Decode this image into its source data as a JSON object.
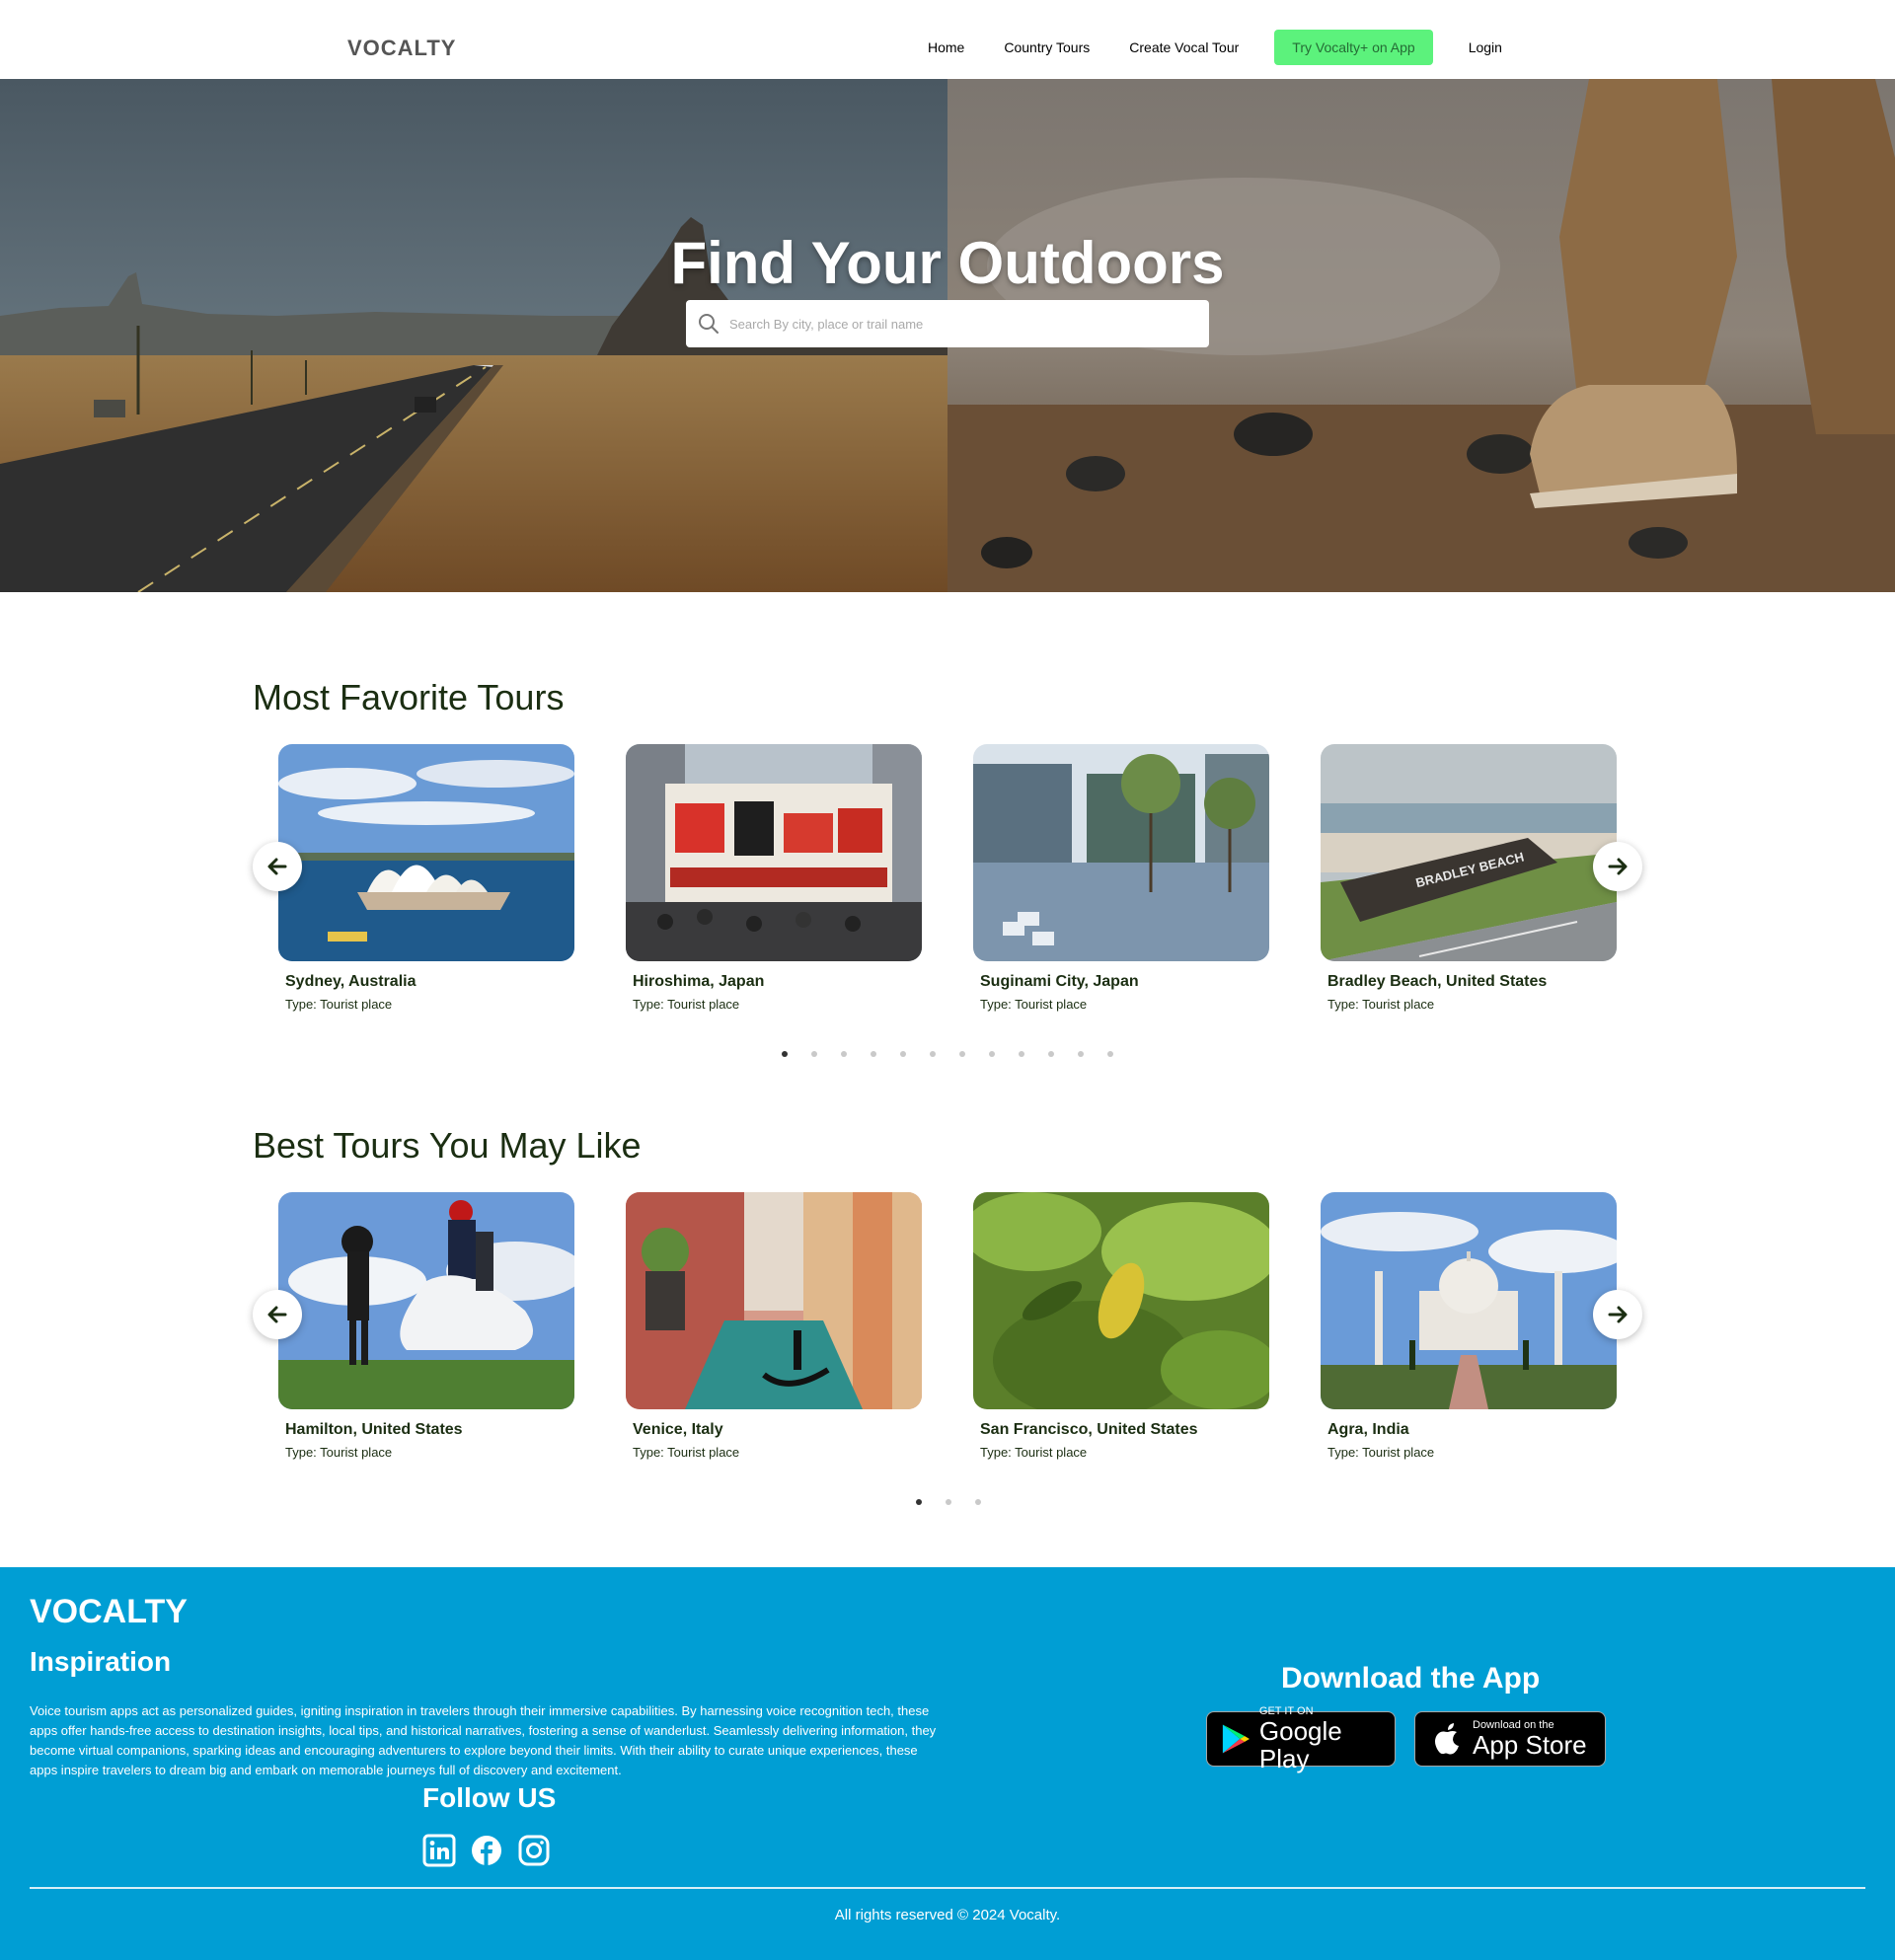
{
  "nav": {
    "brand": "VOCALTY",
    "links": [
      "Home",
      "Country Tours",
      "Create Vocal Tour"
    ],
    "cta": "Try Vocalty+ on App",
    "login": "Login"
  },
  "hero": {
    "title": "Find Your Outdoors",
    "search_placeholder": "Search By city, place or trail name"
  },
  "favorites": {
    "title": "Most Favorite Tours",
    "cards": [
      {
        "title": "Sydney, Australia",
        "type": "Type: Tourist place"
      },
      {
        "title": "Hiroshima, Japan",
        "type": "Type: Tourist place"
      },
      {
        "title": "Suginami City, Japan",
        "type": "Type: Tourist place"
      },
      {
        "title": "Bradley Beach, United States",
        "type": "Type: Tourist place",
        "sign": "BRADLEY BEACH"
      }
    ],
    "dot_count": 12,
    "active_dot": 0
  },
  "best": {
    "title": "Best Tours You May Like",
    "cards": [
      {
        "title": "Hamilton, United States",
        "type": "Type: Tourist place"
      },
      {
        "title": "Venice, Italy",
        "type": "Type: Tourist place"
      },
      {
        "title": "San Francisco, United States",
        "type": "Type: Tourist place"
      },
      {
        "title": "Agra, India",
        "type": "Type: Tourist place"
      }
    ],
    "dot_count": 3,
    "active_dot": 0
  },
  "footer": {
    "brand": "VOCALTY",
    "inspiration_title": "Inspiration",
    "inspiration_text": "Voice tourism apps act as personalized guides, igniting inspiration in travelers through their immersive capabilities. By harnessing voice recognition tech, these apps offer hands-free access to destination insights, local tips, and historical narratives, fostering a sense of wanderlust. Seamlessly delivering information, they become virtual companions, sparking ideas and encouraging adventurers to explore beyond their limits. With their ability to curate unique experiences, these apps inspire travelers to dream big and embark on memorable journeys full of discovery and excitement.",
    "follow_title": "Follow US",
    "socials": [
      "linkedin-icon",
      "facebook-icon",
      "instagram-icon"
    ],
    "download_title": "Download the App",
    "google_play": {
      "small": "GET IT ON",
      "big": "Google Play"
    },
    "app_store": {
      "small": "Download on the",
      "big": "App Store"
    },
    "copyright": "All rights reserved © 2024 Vocalty."
  },
  "colors": {
    "cta_bg": "#5cf27c",
    "cta_text": "#256b35",
    "footer_bg": "#009ed4",
    "heading": "#1b2e12"
  }
}
